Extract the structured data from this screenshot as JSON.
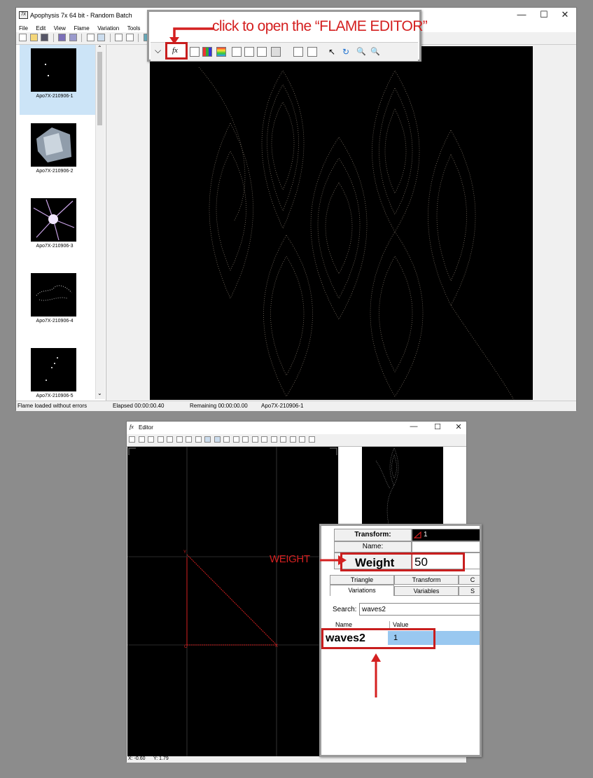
{
  "main_window": {
    "title": "Apophysis 7x 64 bit - Random Batch",
    "icon_label": "7X",
    "window_controls": {
      "minimize": "—",
      "maximize": "☐",
      "close": "✕"
    },
    "menu": [
      "File",
      "Edit",
      "View",
      "Flame",
      "Variation",
      "Tools",
      "?"
    ],
    "thumbnails": [
      {
        "label": "Apo7X-210906-1"
      },
      {
        "label": "Apo7X-210906-2"
      },
      {
        "label": "Apo7X-210906-3"
      },
      {
        "label": "Apo7X-210906-4"
      },
      {
        "label": "Apo7X-210906-5"
      }
    ],
    "status": {
      "message": "Flame loaded without errors",
      "elapsed": "Elapsed 00:00:00.40",
      "remaining": "Remaining 00:00:00.00",
      "flame": "Apo7X-210906-1"
    }
  },
  "annotations": {
    "editor_hint": "click to open the “FLAME EDITOR”",
    "weight_label": "WEIGHT",
    "waves2_label": "waves2"
  },
  "toolbar_callout": {
    "dropdown": "⌵",
    "editor_button": "fx"
  },
  "editor_window": {
    "title": "Editor",
    "icon": "fx",
    "window_controls": {
      "minimize": "—",
      "maximize": "☐",
      "close": "✕"
    },
    "coords": {
      "x": "X: -0.60",
      "y": "Y: 1.79"
    },
    "triangle_labels": {
      "x_vertex": "X",
      "y_vertex": "Y",
      "origin": "O"
    }
  },
  "transform_panel": {
    "transform_label": "Transform:",
    "transform_value": "1",
    "name_label": "Name:",
    "weight_label": "Weight",
    "weight_value": "50",
    "tabs_row1": [
      "Triangle",
      "Transform",
      "C"
    ],
    "tabs_row2": [
      "Variations",
      "Variables",
      "S"
    ],
    "search_label": "Search:",
    "search_value": "waves2",
    "col_name": "Name",
    "col_value": "Value",
    "variation_name": "waves2",
    "variation_value": "1"
  },
  "colors": {
    "accent_red": "#d42020",
    "selection": "#cce4f7",
    "row_highlight": "#99c8f0"
  }
}
